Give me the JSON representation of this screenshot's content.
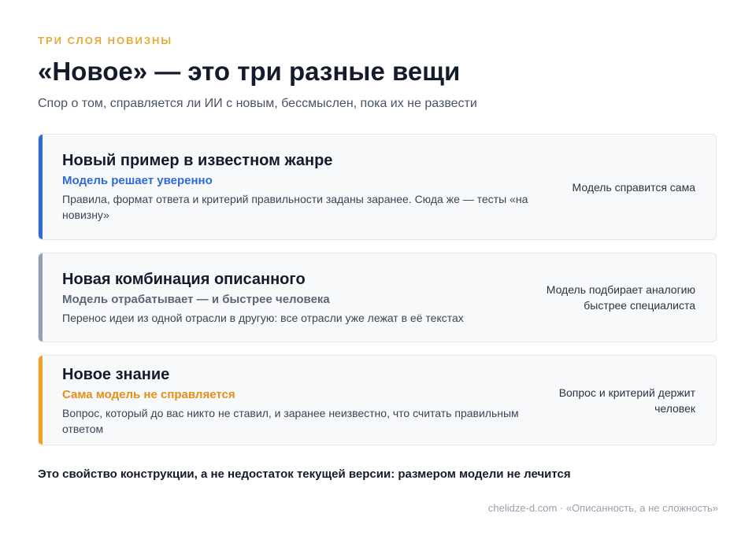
{
  "header": {
    "eyebrow": "ТРИ СЛОЯ НОВИЗНЫ",
    "title": "«Новое» — это три разные вещи",
    "subtitle": "Спор о том, справляется ли ИИ с новым, бессмыслен, пока их не развести"
  },
  "colors": {
    "accent_eyebrow": "#e8a93a",
    "card1_accent": "#2f6ad8",
    "card2_accent": "#94a0b4",
    "card3_accent": "#f2a11e"
  },
  "cards": [
    {
      "heading": "Новый пример в известном жанре",
      "verdict": "Модель решает уверенно",
      "description": "Правила, формат ответа и критерий правильности заданы заранее. Сюда же — тесты «на новизну»",
      "side": "Модель справится сама"
    },
    {
      "heading": "Новая комбинация описанного",
      "verdict": "Модель отрабатывает — и быстрее человека",
      "description": "Перенос идеи из одной отрасли в другую: все отрасли уже лежат в её текстах",
      "side": "Модель подбирает аналогию быстрее специалиста"
    },
    {
      "heading": "Новое знание",
      "verdict": "Сама модель не справляется",
      "description": "Вопрос, который до вас никто не ставил, и заранее неизвестно, что считать правильным ответом",
      "side": "Вопрос и критерий держит человек"
    }
  ],
  "conclusion": "Это свойство конструкции, а не недостаток текущей версии: размером модели не лечится",
  "footer": "chelidze-d.com · «Описанность, а не сложность»"
}
